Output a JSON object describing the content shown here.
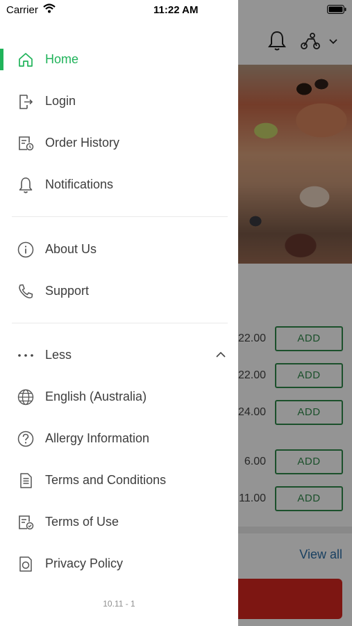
{
  "status_bar": {
    "carrier": "Carrier",
    "time": "11:22 AM"
  },
  "menu": {
    "primary": [
      {
        "label": "Home",
        "icon": "home-icon",
        "active": true
      },
      {
        "label": "Login",
        "icon": "login-icon"
      },
      {
        "label": "Order History",
        "icon": "order-history-icon"
      },
      {
        "label": "Notifications",
        "icon": "bell-icon"
      }
    ],
    "secondary": [
      {
        "label": "About Us",
        "icon": "info-icon"
      },
      {
        "label": "Support",
        "icon": "phone-icon"
      }
    ],
    "more_toggle": {
      "label": "Less",
      "icon": "more-dots-icon",
      "expanded": true
    },
    "extra": [
      {
        "label": "English (Australia)",
        "icon": "globe-icon"
      },
      {
        "label": "Allergy Information",
        "icon": "question-icon"
      },
      {
        "label": "Terms and Conditions",
        "icon": "document-icon"
      },
      {
        "label": "Terms of Use",
        "icon": "document-check-icon"
      },
      {
        "label": "Privacy Policy",
        "icon": "privacy-icon"
      }
    ],
    "version": "10.11 - 1"
  },
  "background": {
    "items": [
      {
        "price": "22.00",
        "action": "ADD"
      },
      {
        "price": "22.00",
        "action": "ADD"
      },
      {
        "price": "24.00",
        "action": "ADD"
      },
      {
        "price": "6.00",
        "action": "ADD"
      },
      {
        "price": "11.00",
        "action": "ADD"
      }
    ],
    "view_all": "View all"
  },
  "colors": {
    "accent": "#20b35a",
    "add_button": "#2f8a4a",
    "view_all_link": "#2c6fa8",
    "checkout_bar": "#d8261f"
  }
}
